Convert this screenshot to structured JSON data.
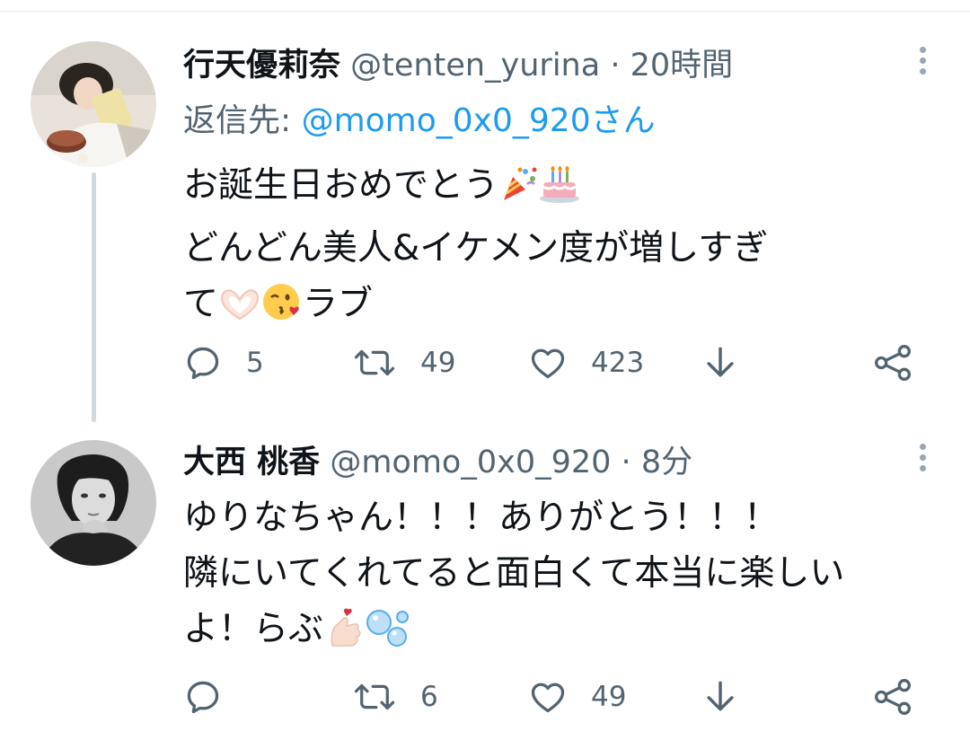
{
  "tweets": [
    {
      "name": "行天優莉奈",
      "handle": "@tenten_yurina",
      "separator": "·",
      "time": "20時間",
      "reply_to_label": "返信先: ",
      "reply_to_mention": "@momo_0x0_920さん",
      "lines": [
        "お誕生日おめでとう",
        "どんどん美人&イケメン度が増しすぎ",
        "て",
        "ラブ"
      ],
      "emojis": [
        "party-popper",
        "birthday-cake",
        "heart-hands",
        "face-blowing-kiss"
      ],
      "replies": "5",
      "retweets": "49",
      "likes": "423"
    },
    {
      "name": "大西 桃香",
      "handle": "@momo_0x0_920",
      "separator": "·",
      "time": "8分",
      "lines": [
        "ゆりなちゃん！！！ありがとう！！！",
        "隣にいてくれてると面白くて本当に楽しい",
        "よ！らぶ"
      ],
      "emojis": [
        "finger-heart",
        "bubbles"
      ],
      "replies": "",
      "retweets": "6",
      "likes": "49"
    }
  ],
  "colors": {
    "text": "#0f1419",
    "secondary": "#536471",
    "link": "#1d9bf0",
    "thread_line": "#cfd9de"
  }
}
